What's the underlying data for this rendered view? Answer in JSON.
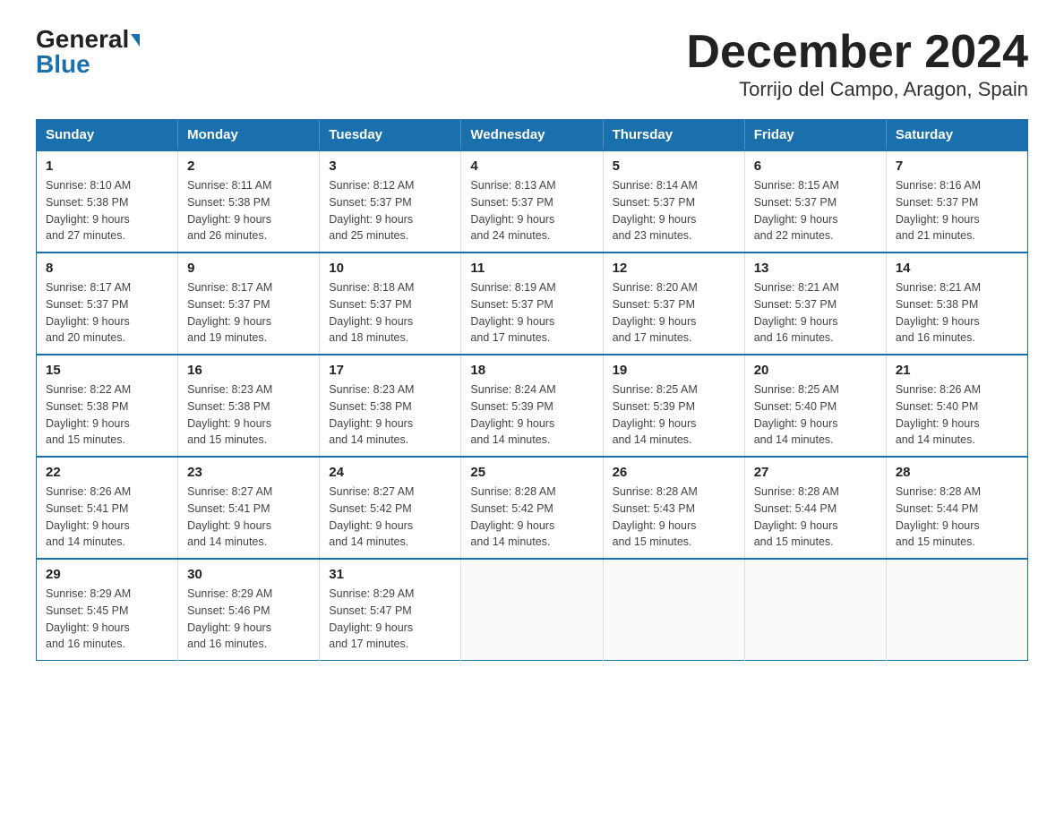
{
  "logo": {
    "general": "General",
    "blue": "Blue"
  },
  "title": "December 2024",
  "subtitle": "Torrijo del Campo, Aragon, Spain",
  "days_of_week": [
    "Sunday",
    "Monday",
    "Tuesday",
    "Wednesday",
    "Thursday",
    "Friday",
    "Saturday"
  ],
  "weeks": [
    [
      {
        "day": "1",
        "sunrise": "8:10 AM",
        "sunset": "5:38 PM",
        "daylight": "9 hours and 27 minutes."
      },
      {
        "day": "2",
        "sunrise": "8:11 AM",
        "sunset": "5:38 PM",
        "daylight": "9 hours and 26 minutes."
      },
      {
        "day": "3",
        "sunrise": "8:12 AM",
        "sunset": "5:37 PM",
        "daylight": "9 hours and 25 minutes."
      },
      {
        "day": "4",
        "sunrise": "8:13 AM",
        "sunset": "5:37 PM",
        "daylight": "9 hours and 24 minutes."
      },
      {
        "day": "5",
        "sunrise": "8:14 AM",
        "sunset": "5:37 PM",
        "daylight": "9 hours and 23 minutes."
      },
      {
        "day": "6",
        "sunrise": "8:15 AM",
        "sunset": "5:37 PM",
        "daylight": "9 hours and 22 minutes."
      },
      {
        "day": "7",
        "sunrise": "8:16 AM",
        "sunset": "5:37 PM",
        "daylight": "9 hours and 21 minutes."
      }
    ],
    [
      {
        "day": "8",
        "sunrise": "8:17 AM",
        "sunset": "5:37 PM",
        "daylight": "9 hours and 20 minutes."
      },
      {
        "day": "9",
        "sunrise": "8:17 AM",
        "sunset": "5:37 PM",
        "daylight": "9 hours and 19 minutes."
      },
      {
        "day": "10",
        "sunrise": "8:18 AM",
        "sunset": "5:37 PM",
        "daylight": "9 hours and 18 minutes."
      },
      {
        "day": "11",
        "sunrise": "8:19 AM",
        "sunset": "5:37 PM",
        "daylight": "9 hours and 17 minutes."
      },
      {
        "day": "12",
        "sunrise": "8:20 AM",
        "sunset": "5:37 PM",
        "daylight": "9 hours and 17 minutes."
      },
      {
        "day": "13",
        "sunrise": "8:21 AM",
        "sunset": "5:37 PM",
        "daylight": "9 hours and 16 minutes."
      },
      {
        "day": "14",
        "sunrise": "8:21 AM",
        "sunset": "5:38 PM",
        "daylight": "9 hours and 16 minutes."
      }
    ],
    [
      {
        "day": "15",
        "sunrise": "8:22 AM",
        "sunset": "5:38 PM",
        "daylight": "9 hours and 15 minutes."
      },
      {
        "day": "16",
        "sunrise": "8:23 AM",
        "sunset": "5:38 PM",
        "daylight": "9 hours and 15 minutes."
      },
      {
        "day": "17",
        "sunrise": "8:23 AM",
        "sunset": "5:38 PM",
        "daylight": "9 hours and 14 minutes."
      },
      {
        "day": "18",
        "sunrise": "8:24 AM",
        "sunset": "5:39 PM",
        "daylight": "9 hours and 14 minutes."
      },
      {
        "day": "19",
        "sunrise": "8:25 AM",
        "sunset": "5:39 PM",
        "daylight": "9 hours and 14 minutes."
      },
      {
        "day": "20",
        "sunrise": "8:25 AM",
        "sunset": "5:40 PM",
        "daylight": "9 hours and 14 minutes."
      },
      {
        "day": "21",
        "sunrise": "8:26 AM",
        "sunset": "5:40 PM",
        "daylight": "9 hours and 14 minutes."
      }
    ],
    [
      {
        "day": "22",
        "sunrise": "8:26 AM",
        "sunset": "5:41 PM",
        "daylight": "9 hours and 14 minutes."
      },
      {
        "day": "23",
        "sunrise": "8:27 AM",
        "sunset": "5:41 PM",
        "daylight": "9 hours and 14 minutes."
      },
      {
        "day": "24",
        "sunrise": "8:27 AM",
        "sunset": "5:42 PM",
        "daylight": "9 hours and 14 minutes."
      },
      {
        "day": "25",
        "sunrise": "8:28 AM",
        "sunset": "5:42 PM",
        "daylight": "9 hours and 14 minutes."
      },
      {
        "day": "26",
        "sunrise": "8:28 AM",
        "sunset": "5:43 PM",
        "daylight": "9 hours and 15 minutes."
      },
      {
        "day": "27",
        "sunrise": "8:28 AM",
        "sunset": "5:44 PM",
        "daylight": "9 hours and 15 minutes."
      },
      {
        "day": "28",
        "sunrise": "8:28 AM",
        "sunset": "5:44 PM",
        "daylight": "9 hours and 15 minutes."
      }
    ],
    [
      {
        "day": "29",
        "sunrise": "8:29 AM",
        "sunset": "5:45 PM",
        "daylight": "9 hours and 16 minutes."
      },
      {
        "day": "30",
        "sunrise": "8:29 AM",
        "sunset": "5:46 PM",
        "daylight": "9 hours and 16 minutes."
      },
      {
        "day": "31",
        "sunrise": "8:29 AM",
        "sunset": "5:47 PM",
        "daylight": "9 hours and 17 minutes."
      },
      null,
      null,
      null,
      null
    ]
  ],
  "labels": {
    "sunrise": "Sunrise:",
    "sunset": "Sunset:",
    "daylight": "Daylight:"
  }
}
